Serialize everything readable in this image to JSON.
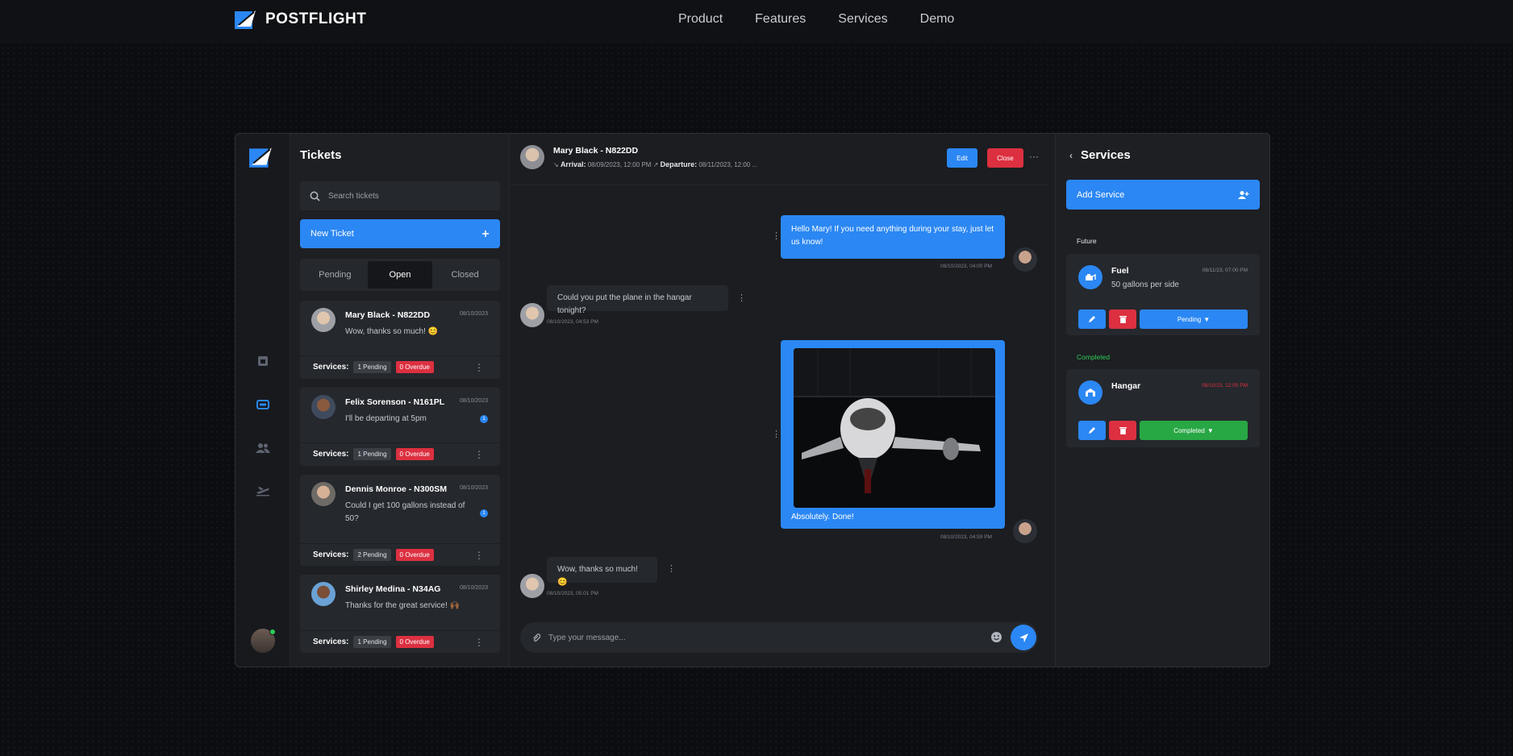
{
  "site": {
    "brand": "POSTFLIGHT",
    "nav": [
      "Product",
      "Features",
      "Services",
      "Demo"
    ]
  },
  "tickets": {
    "title": "Tickets",
    "search_placeholder": "Search tickets",
    "new_ticket_label": "New Ticket",
    "tabs": [
      "Pending",
      "Open",
      "Closed"
    ],
    "active_tab": "Open",
    "services_label": "Services:",
    "items": [
      {
        "name": "Mary Black - N822DD",
        "date": "08/10/2023",
        "message": "Wow, thanks so much! 😊",
        "unread": "",
        "pending": "1 Pending",
        "overdue": "0 Overdue"
      },
      {
        "name": "Felix Sorenson - N161PL",
        "date": "08/10/2023",
        "message": "I'll be departing at 5pm",
        "unread": "1",
        "pending": "1 Pending",
        "overdue": "0 Overdue"
      },
      {
        "name": "Dennis Monroe - N300SM",
        "date": "08/10/2023",
        "message": "Could I get 100 gallons instead of 50?",
        "unread": "1",
        "pending": "2 Pending",
        "overdue": "0 Overdue"
      },
      {
        "name": "Shirley Medina - N34AG",
        "date": "08/10/2023",
        "message": "Thanks for the great service! 🙌🏾",
        "unread": "",
        "pending": "1 Pending",
        "overdue": "0 Overdue"
      }
    ]
  },
  "chat": {
    "contact": "Mary Black - N822DD",
    "arrival_label": "Arrival:",
    "arrival": "08/09/2023, 12:00 PM",
    "departure_label": "Departure:",
    "departure": "08/11/2023, 12:00 ...",
    "edit_label": "Edit",
    "close_label": "Close",
    "messages": [
      {
        "text": "Hello Mary! If you need anything during your stay, just let us know!",
        "time": "08/10/2023, 04:00 PM"
      },
      {
        "text": "Could you put the plane in the hangar tonight?",
        "time": "08/10/2023, 04:53 PM"
      },
      {
        "text": "Absolutely. Done!",
        "time": "08/10/2023, 04:59 PM"
      },
      {
        "text": "Wow, thanks so much! 😊",
        "time": "08/10/2023, 05:01 PM"
      }
    ],
    "composer_placeholder": "Type your message..."
  },
  "services": {
    "title": "Services",
    "add_label": "Add Service",
    "future_label": "Future",
    "completed_label": "Completed",
    "items": [
      {
        "name": "Fuel",
        "desc": "50 gallons per side",
        "date": "08/11/23, 07:00 PM",
        "status": "Pending",
        "date_color": "#8a9099"
      },
      {
        "name": "Hangar",
        "desc": "",
        "date": "08/10/23, 12:05 PM",
        "status": "Completed",
        "date_color": "#dc3040"
      }
    ]
  },
  "colors": {
    "accent": "#2b87f3",
    "danger": "#dc3040",
    "success": "#28a745",
    "completed_text": "#2ecc55"
  },
  "icons": [
    "logo-mark-icon",
    "search-icon",
    "plus-icon",
    "kebab-icon",
    "paperclip-icon",
    "emoji-icon",
    "send-icon",
    "pencil-icon",
    "trash-icon",
    "caret-down-icon",
    "fuel-icon",
    "hangar-icon",
    "add-user-icon",
    "chevron-left-icon",
    "arrival-arrow-icon",
    "departure-arrow-icon",
    "calendar-icon",
    "ticket-icon",
    "users-icon",
    "plane-icon"
  ]
}
